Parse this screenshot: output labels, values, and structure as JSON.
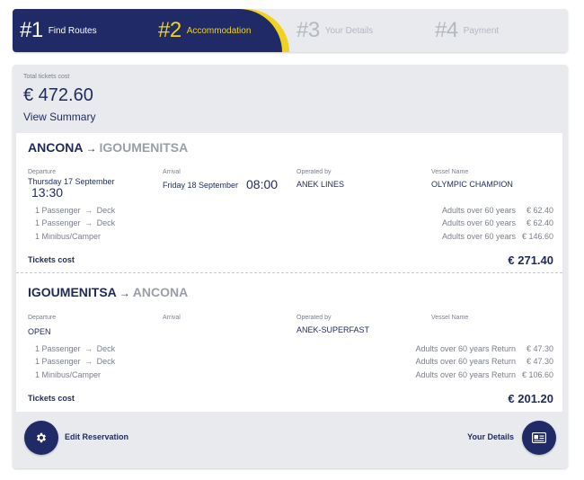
{
  "steps": [
    {
      "num": "#1",
      "label": "Find Routes"
    },
    {
      "num": "#2",
      "label": "Accommodation"
    },
    {
      "num": "#3",
      "label": "Your Details"
    },
    {
      "num": "#4",
      "label": "Payment"
    }
  ],
  "summary": {
    "total_label": "Total tickets cost",
    "total_value": "€ 472.60",
    "view_summary": "View Summary"
  },
  "column_labels": {
    "departure": "Departure",
    "arrival": "Arrival",
    "operated_by": "Operated by",
    "vessel_name": "Vessel Name"
  },
  "trips": [
    {
      "origin": "ANCONA",
      "arrow": "→",
      "destination": "IGOUMENITSA",
      "departure_date": "Thursday 17 September",
      "departure_time": "13:30",
      "arrival_date": "Friday 18 September",
      "arrival_time": "08:00",
      "operator": "ANEK LINES",
      "vessel": "OLYMPIC CHAMPION",
      "items": [
        {
          "qty": "1 Passenger",
          "arrow": "→",
          "type": "Deck",
          "fare": "Adults over 60 years",
          "price": "€ 62.40"
        },
        {
          "qty": "1 Passenger",
          "arrow": "→",
          "type": "Deck",
          "fare": "Adults over 60 years",
          "price": "€ 62.40"
        },
        {
          "qty": "1 Minibus/Camper",
          "arrow": "",
          "type": "",
          "fare": "Adults over 60 years",
          "price": "€ 146.60"
        }
      ],
      "tickets_cost_label": "Tickets cost",
      "tickets_cost": "€ 271.40"
    },
    {
      "origin": "IGOUMENITSA",
      "arrow": "→",
      "destination": "ANCONA",
      "departure_date": "OPEN",
      "departure_time": "",
      "arrival_date": "",
      "arrival_time": "",
      "operator": "ANEK-SUPERFAST",
      "vessel": "",
      "items": [
        {
          "qty": "1 Passenger",
          "arrow": "→",
          "type": "Deck",
          "fare": "Adults over 60 years Return",
          "price": "€ 47.30"
        },
        {
          "qty": "1 Passenger",
          "arrow": "→",
          "type": "Deck",
          "fare": "Adults over 60 years Return",
          "price": "€ 47.30"
        },
        {
          "qty": "1 Minibus/Camper",
          "arrow": "",
          "type": "",
          "fare": "Adults over 60 years Return",
          "price": "€ 106.60"
        }
      ],
      "tickets_cost_label": "Tickets cost",
      "tickets_cost": "€ 201.20"
    }
  ],
  "actions": {
    "edit_label": "Edit Reservation",
    "edit_icon": "gear-icon",
    "details_label": "Your Details",
    "details_icon": "id-card-icon"
  },
  "colors": {
    "brand_navy": "#1f2a66",
    "accent_yellow": "#f1d21e",
    "panel_bg": "#e8eaee"
  }
}
